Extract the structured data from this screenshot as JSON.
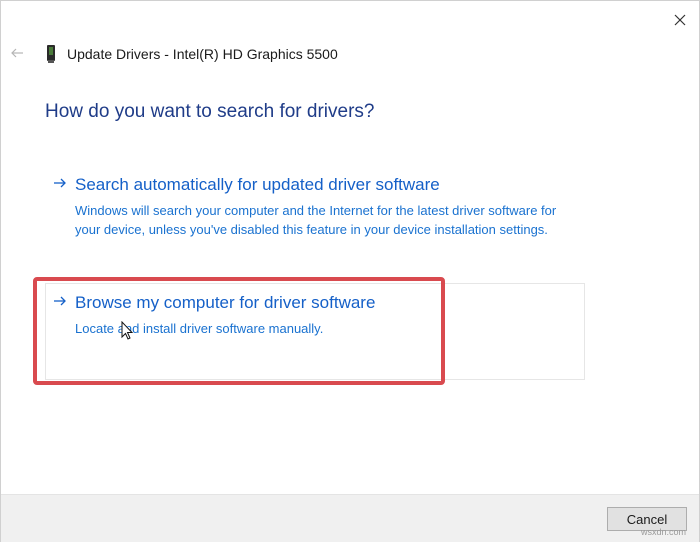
{
  "window": {
    "title": "Update Drivers - Intel(R) HD Graphics 5500",
    "heading": "How do you want to search for drivers?"
  },
  "icons": {
    "back": "back-arrow-icon",
    "device": "graphics-device-icon",
    "close": "close-icon",
    "option_arrow": "right-arrow-icon",
    "cursor": "mouse-pointer-icon"
  },
  "options": [
    {
      "title": "Search automatically for updated driver software",
      "description": "Windows will search your computer and the Internet for the latest driver software for your device, unless you've disabled this feature in your device installation settings."
    },
    {
      "title": "Browse my computer for driver software",
      "description": "Locate and install driver software manually."
    }
  ],
  "footer": {
    "cancel_label": "Cancel"
  },
  "watermark": "wsxdn.com",
  "colors": {
    "heading": "#1f3c88",
    "link": "#1560c8",
    "description": "#1a72d0",
    "highlight": "#d94a4f"
  }
}
